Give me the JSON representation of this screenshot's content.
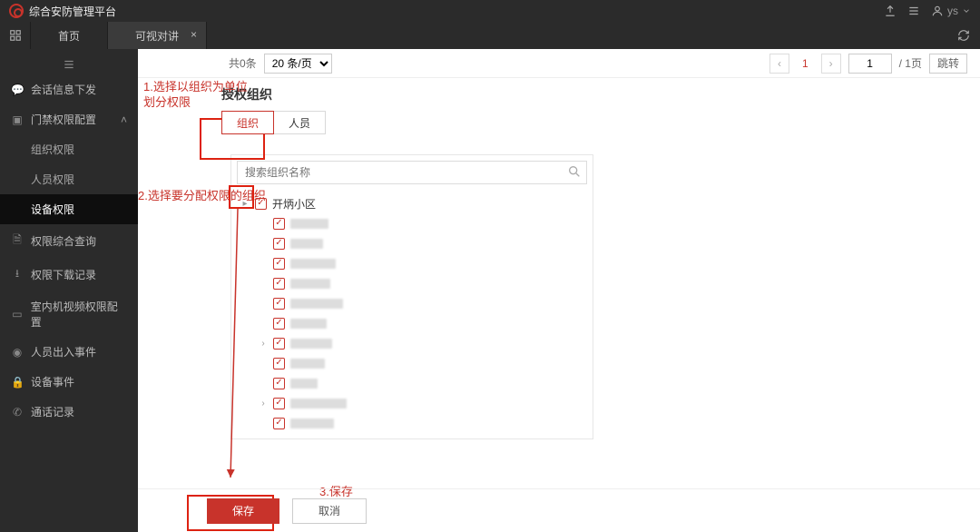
{
  "app": {
    "title": "综合安防管理平台",
    "user": "ys"
  },
  "tabs": {
    "home": "首页",
    "video": "可视对讲"
  },
  "sidebar": {
    "session": "会话信息下发",
    "access": {
      "label": "门禁权限配置",
      "org": "组织权限",
      "person": "人员权限",
      "device": "设备权限"
    },
    "query": "权限综合查询",
    "download": "权限下载记录",
    "indoor": "室内机视频权限配置",
    "event": "人员出入事件",
    "devevt": "设备事件",
    "call": "通话记录"
  },
  "pager": {
    "total": "共0条",
    "pageSize": "20 条/页",
    "current": "1",
    "pageInput": "1",
    "totalPages": "/ 1页",
    "jump": "跳转"
  },
  "panel": {
    "title": "授权组织",
    "tab_org": "组织",
    "tab_person": "人员",
    "search_placeholder": "搜索组织名称",
    "root": "开炳小区"
  },
  "footer": {
    "save": "保存",
    "cancel": "取消"
  },
  "annotations": {
    "a1": "1.选择以组织为单位划分权限",
    "a2": "2.选择要分配权限的组织",
    "a3": "3.保存"
  }
}
